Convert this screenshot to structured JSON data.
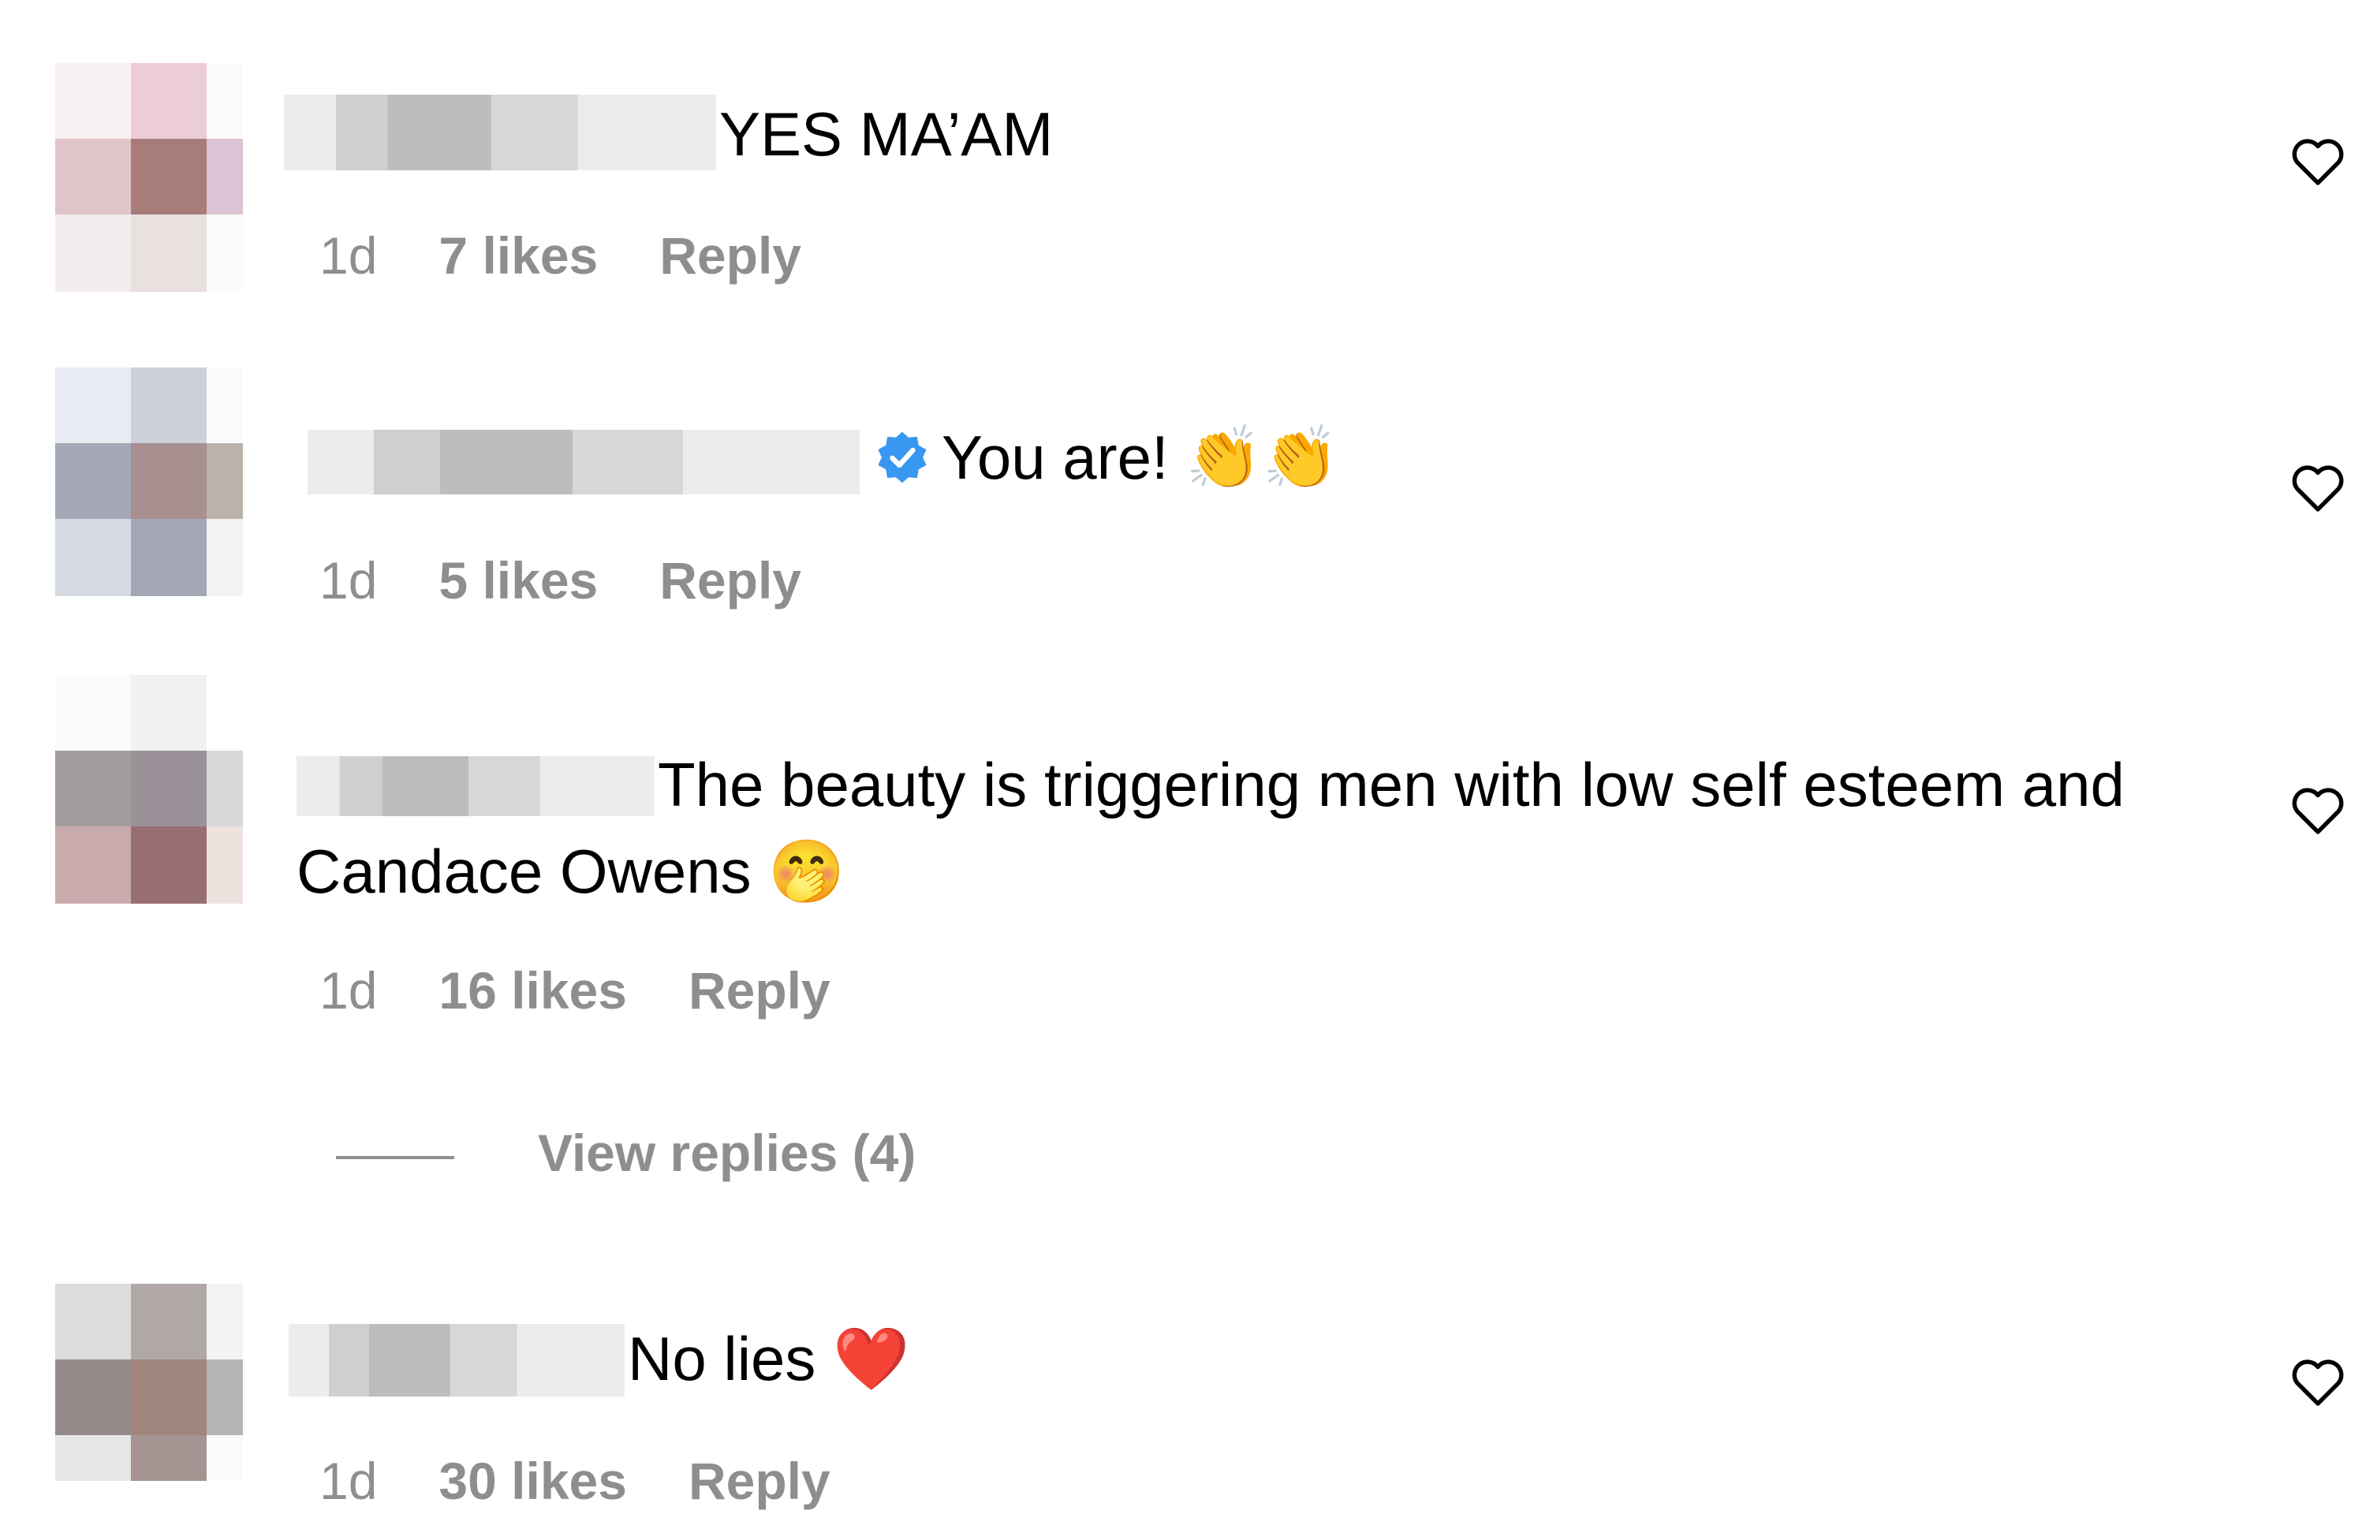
{
  "comments": [
    {
      "text": "YES MA’AM",
      "emoji": "",
      "time": "1d",
      "likes": "7 likes",
      "reply": "Reply"
    },
    {
      "text": "You are!",
      "emoji": "👏👏",
      "time": "1d",
      "likes": "5 likes",
      "reply": "Reply"
    },
    {
      "text": "The beauty is triggering men with low self esteem and Candace Owens",
      "emoji": "🤭",
      "time": "1d",
      "likes": "16 likes",
      "reply": "Reply"
    },
    {
      "text": "No lies",
      "emoji": "❤️",
      "time": "1d",
      "likes": "30 likes",
      "reply": "Reply"
    }
  ],
  "view_replies": "View replies (4)",
  "icons": {
    "like": "heart-outline-icon",
    "verified": "verified-badge-icon"
  },
  "colors": {
    "text": "#000000",
    "meta": "#8e8e8e",
    "verified": "#3897f0",
    "avatars": [
      [
        "#f8f1f1",
        "#ecccd6",
        "#fbf9fa",
        "#dfc4c9",
        "#a87c78",
        "#ddc3d6",
        "#f3eded",
        "#e9e0e0",
        "#fcfbfb"
      ],
      [
        "#e8ebf2",
        "#cdd0db",
        "#fafafa",
        "#a4a7b5",
        "#a89090",
        "#bbb2aa",
        "#d5d9e2",
        "#a2a6b5",
        "#f3f3f3"
      ],
      [
        "#fcfbfa",
        "#f1f1f1",
        "#ffffff",
        "#a39c9c",
        "#9a9199",
        "#d9d7da",
        "#c9aaad",
        "#986e73",
        "#eee2de"
      ],
      [
        "#dcdcdc",
        "#afa8a6",
        "#f2f4f2",
        "#958a8a",
        "#9f857d",
        "#b5b5b5",
        "#e7e7e7",
        "#a59491",
        "#fafafa"
      ]
    ]
  }
}
